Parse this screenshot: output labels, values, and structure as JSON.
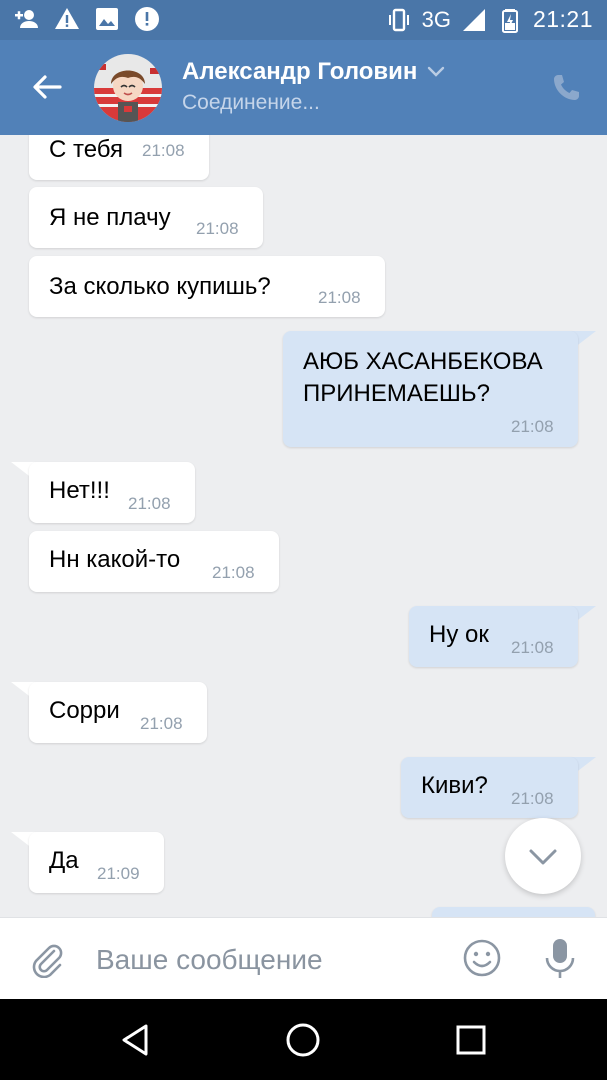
{
  "status_bar": {
    "network": "3G",
    "network_small": "3G",
    "time": "21:21"
  },
  "header": {
    "contact_name": "Александр Головин",
    "status": "Соединение..."
  },
  "messages": [
    {
      "dir": "in",
      "text": "С тебя",
      "time": "21:08"
    },
    {
      "dir": "in",
      "text": "Я не плачу",
      "time": "21:08"
    },
    {
      "dir": "in",
      "text": "За сколько купишь?",
      "time": "21:08"
    },
    {
      "dir": "out",
      "text_lines": [
        "АЮБ ХАСАНБЕКОВА",
        "ПРИНЕМАЕШЬ?"
      ],
      "time": "21:08"
    },
    {
      "dir": "in",
      "text": "Нет!!!",
      "time": "21:08"
    },
    {
      "dir": "in",
      "text": "Нн какой-то",
      "time": "21:08"
    },
    {
      "dir": "out",
      "text": "Ну ок",
      "time": "21:08"
    },
    {
      "dir": "in",
      "text": "Сорри",
      "time": "21:08"
    },
    {
      "dir": "out",
      "text": "Киви?",
      "time": "21:08"
    },
    {
      "dir": "in",
      "text": "Да",
      "time": "21:09"
    }
  ],
  "composer": {
    "placeholder": "Ваше сообщение"
  },
  "colors": {
    "status_bar": "#4a76a8",
    "toolbar": "#5181b8",
    "incoming_bubble": "#ffffff",
    "outgoing_bubble": "#d6e4f5",
    "background": "#edeef0"
  },
  "icons": [
    "add-person-icon",
    "warning-icon",
    "image-icon",
    "alert-icon",
    "vibrate-icon",
    "signal-icon",
    "battery-icon",
    "back-arrow-icon",
    "chevron-down-icon",
    "phone-icon",
    "paperclip-icon",
    "emoji-icon",
    "microphone-icon",
    "nav-back-icon",
    "nav-home-icon",
    "nav-recents-icon"
  ]
}
